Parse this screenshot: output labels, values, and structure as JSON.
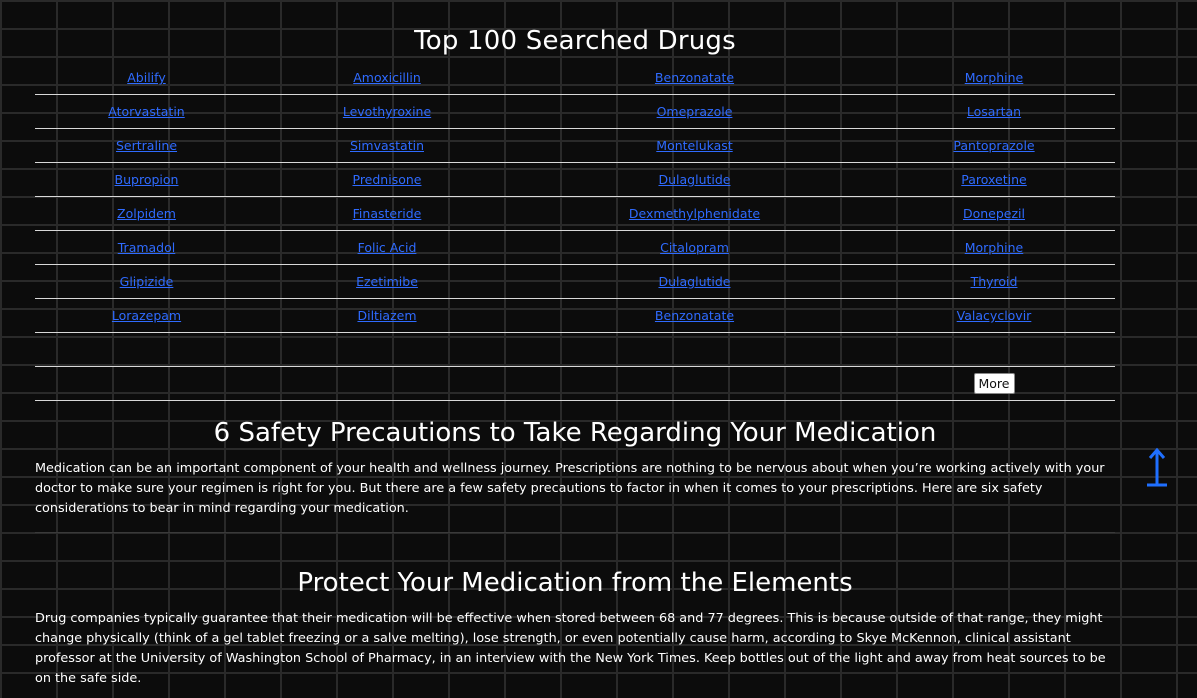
{
  "top_drugs": {
    "title": "Top 100 Searched Drugs",
    "rows": [
      [
        "Abilify",
        "Amoxicillin",
        "Benzonatate",
        "Morphine"
      ],
      [
        "Atorvastatin",
        "Levothyroxine",
        "Omeprazole",
        "Losartan"
      ],
      [
        "Sertraline",
        "Simvastatin",
        "Montelukast",
        "Pantoprazole"
      ],
      [
        "Bupropion",
        "Prednisone",
        "Dulaglutide",
        "Paroxetine"
      ],
      [
        "Zolpidem",
        "Finasteride",
        "Dexmethylphenidate",
        "Donepezil"
      ],
      [
        "Tramadol",
        "Folic Acid",
        "Citalopram",
        "Morphine"
      ],
      [
        "Glipizide",
        "Ezetimibe",
        "Dulaglutide",
        "Thyroid"
      ],
      [
        "Lorazepam",
        "Diltiazem",
        "Benzonatate",
        "Valacyclovir"
      ]
    ],
    "more_label": "More"
  },
  "section1": {
    "heading": "6 Safety Precautions to Take Regarding Your Medication",
    "body": "Medication can be an important component of your health and wellness journey. Prescriptions are nothing to be nervous about when you’re working actively with your doctor to make sure your regimen is right for you. But there are a few safety precautions to factor in when it comes to your prescriptions. Here are six safety considerations to bear in mind regarding your medication."
  },
  "section2": {
    "heading": "Protect Your Medication from the Elements",
    "body": "Drug companies typically guarantee that their medication will be effective when stored between 68 and 77 degrees. This is because outside of that range, they might change physically (think of a gel tablet freezing or a salve melting), lose strength, or even potentially cause harm, according to Skye McKennon, clinical assistant professor at the University of Washington School of Pharmacy, in an interview with the New York Times. Keep bottles out of the light and away from heat sources to be on the safe side."
  },
  "icons": {
    "scroll_top": "arrow-up-icon"
  },
  "colors": {
    "link": "#2f6bff",
    "arrow": "#1f6fff",
    "background": "#0c0c0c"
  }
}
